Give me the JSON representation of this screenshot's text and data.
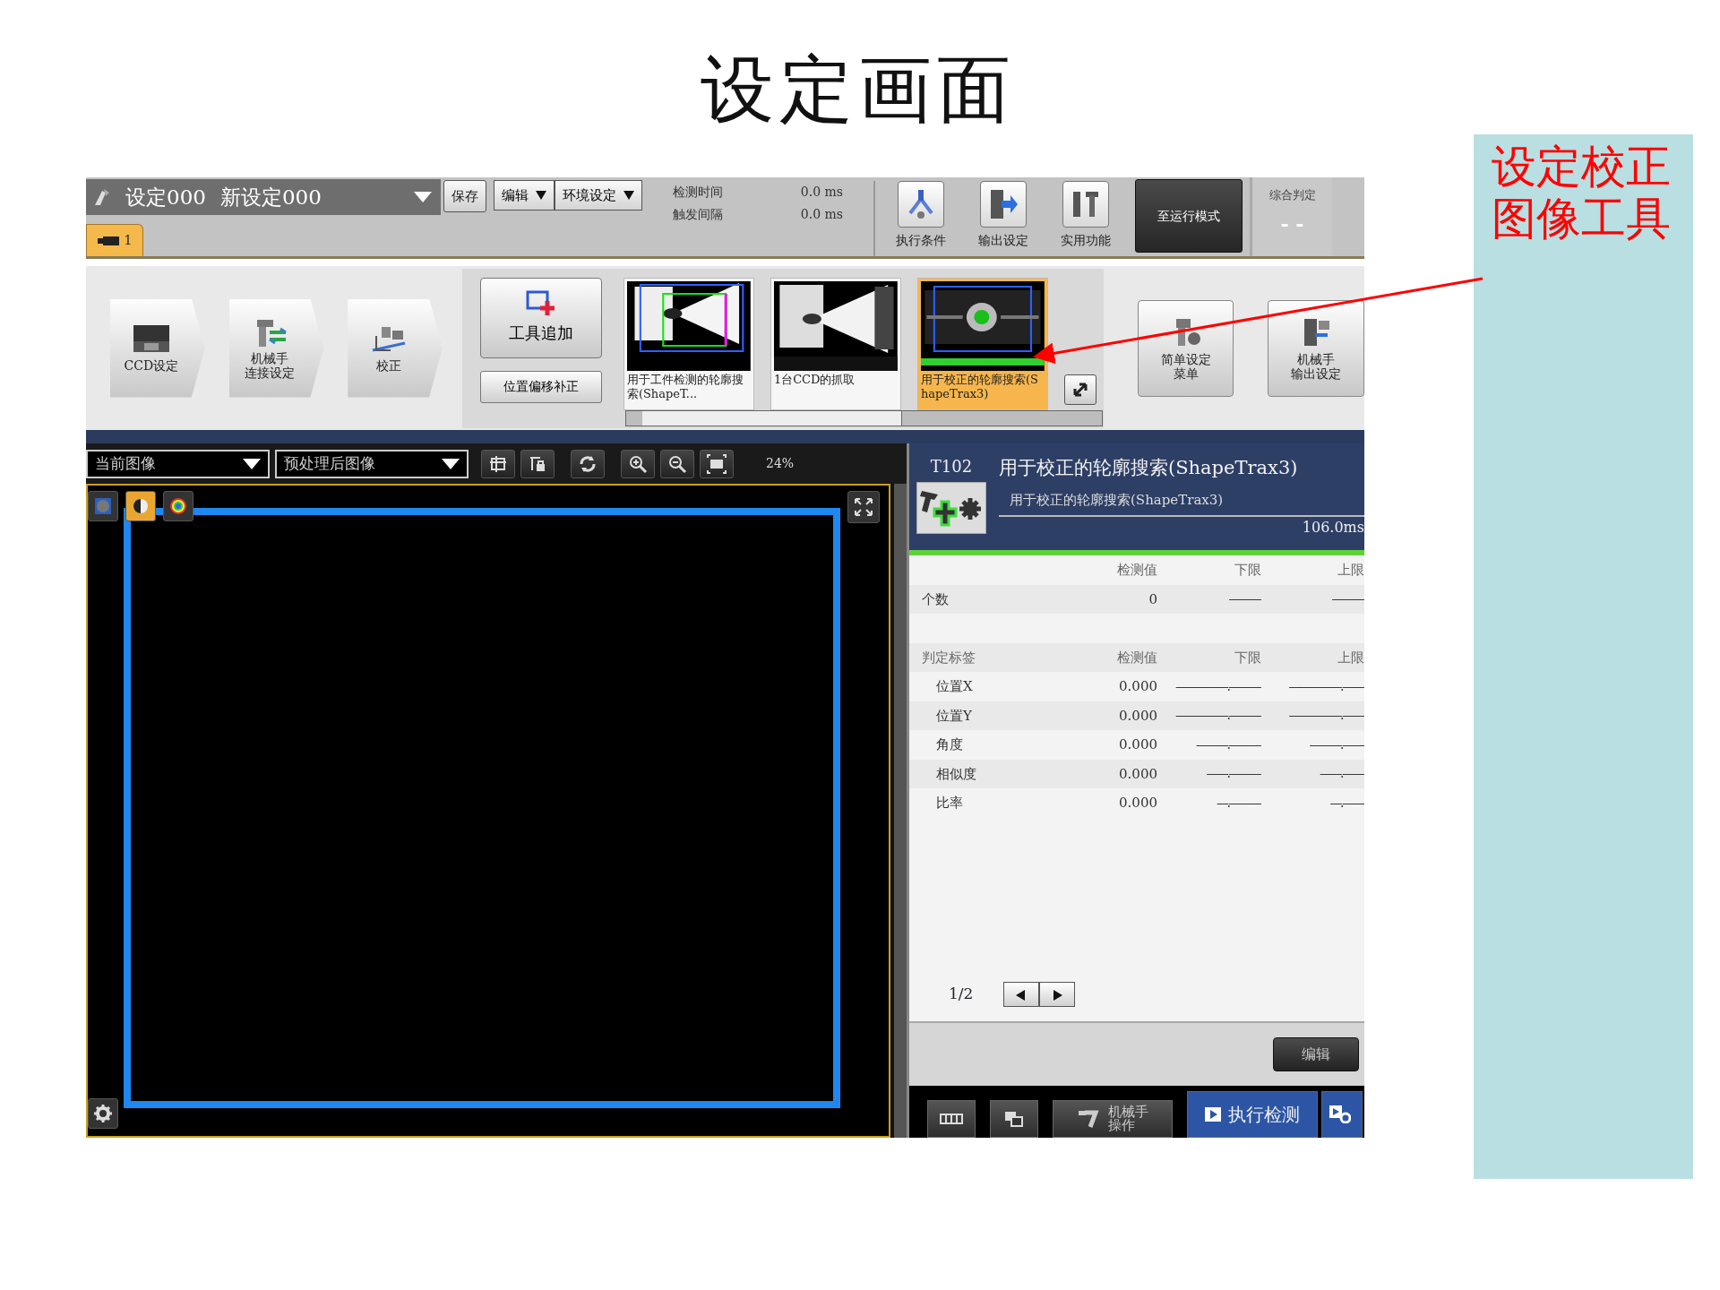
{
  "slide_title": "设定画面",
  "annotation": {
    "text": "设定校正图像工具"
  },
  "header": {
    "scene_number": "设定000",
    "scene_name": "新设定000",
    "save_button": "保存",
    "menus": [
      {
        "label": "编辑"
      },
      {
        "label": "环境设定"
      }
    ],
    "timings": [
      {
        "label": "检测时间",
        "value": "0.0 ms"
      },
      {
        "label": "触发间隔",
        "value": "0.0 ms"
      }
    ],
    "tools": [
      {
        "label": "执行条件"
      },
      {
        "label": "输出设定"
      },
      {
        "label": "实用功能"
      }
    ],
    "run_mode_button": "至运行模式",
    "overall_judgement": {
      "label": "综合判定",
      "value": "- -"
    },
    "tabs": [
      {
        "label": "1",
        "selected": true
      }
    ]
  },
  "flow": {
    "steps": [
      {
        "lines": [
          "CCD设定"
        ]
      },
      {
        "lines": [
          "机械手",
          "连接设定"
        ]
      },
      {
        "lines": [
          "校正"
        ]
      }
    ],
    "add_tool_button": "工具追加",
    "offset_button": "位置偏移补正",
    "tool_thumbnails": [
      {
        "caption": "用于工件检测的轮廓搜索(ShapeT...",
        "selected": false
      },
      {
        "caption": "1台CCD的抓取",
        "selected": false
      },
      {
        "caption": "用于校正的轮廓搜索(ShapeTrax3)",
        "selected": true
      }
    ],
    "menu_buttons": [
      {
        "lines": [
          "简单设定",
          "菜单"
        ]
      },
      {
        "lines": [
          "机械手",
          "输出设定"
        ]
      }
    ]
  },
  "image_view": {
    "source": "当前图像",
    "image_type": "预处理后图像",
    "zoom": "24%",
    "display_modes": [
      {
        "selected": false
      },
      {
        "selected": true
      },
      {
        "selected": false
      }
    ]
  },
  "detail": {
    "tool_id": "T102",
    "title": "用于校正的轮廓搜索(ShapeTrax3)",
    "subtitle": "用于校正的轮廓搜索(ShapeTrax3)",
    "time": "106.0ms",
    "count_table": {
      "columns": [
        "检测值",
        "下限",
        "上限"
      ],
      "rows": [
        {
          "label": "个数",
          "values": [
            "0",
            "———",
            "———"
          ]
        }
      ]
    },
    "judgement_table": {
      "columns": [
        "判定标签",
        "检测值",
        "下限",
        "上限"
      ],
      "rows": [
        {
          "label": "位置X",
          "values": [
            "0.000",
            "—————.———",
            "—————.——"
          ]
        },
        {
          "label": "位置Y",
          "values": [
            "0.000",
            "—————.———",
            "—————.——"
          ]
        },
        {
          "label": "角度",
          "values": [
            "0.000",
            "———.———",
            "———.——"
          ]
        },
        {
          "label": "相似度",
          "values": [
            "0.000",
            "——.———",
            "——.——"
          ]
        },
        {
          "label": "比率",
          "values": [
            "0.000",
            "—.———",
            "—.——"
          ]
        }
      ]
    },
    "page": "1/2",
    "edit_button": "编辑"
  },
  "bottom_buttons": [
    {
      "kind": "grid"
    },
    {
      "kind": "window"
    },
    {
      "kind": "robot",
      "lines": [
        "机械手",
        "操作"
      ]
    },
    {
      "kind": "run",
      "label": "执行检测"
    },
    {
      "kind": "run-extra"
    }
  ]
}
